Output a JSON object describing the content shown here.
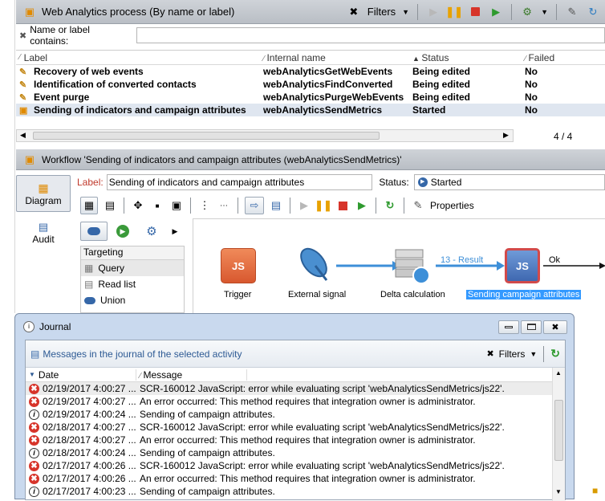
{
  "process": {
    "title": "Web Analytics process (By name or label)",
    "filters_label": "Filters",
    "search_label": "Name or label contains:",
    "search_value": "",
    "columns": [
      "Label",
      "Internal name",
      "Status",
      "Failed"
    ],
    "rows": [
      {
        "label": "Recovery of web events",
        "internal": "webAnalyticsGetWebEvents",
        "status": "Being edited",
        "failed": "No"
      },
      {
        "label": "Identification of converted contacts",
        "internal": "webAnalyticsFindConverted",
        "status": "Being edited",
        "failed": "No"
      },
      {
        "label": "Event purge",
        "internal": "webAnalyticsPurgeWebEvents",
        "status": "Being edited",
        "failed": "No"
      },
      {
        "label": "Sending of indicators and campaign attributes",
        "internal": "webAnalyticsSendMetrics",
        "status": "Started",
        "failed": "No"
      }
    ],
    "pager": "4 / 4"
  },
  "workflow": {
    "title": "Workflow 'Sending of indicators and campaign attributes (webAnalyticsSendMetrics)'",
    "label_caption": "Label:",
    "label_value": "Sending of indicators and campaign attributes",
    "status_caption": "Status:",
    "status_value": "Started",
    "side_diagram": "Diagram",
    "side_audit": "Audit",
    "properties_label": "Properties",
    "palette": {
      "header": "Targeting",
      "items": [
        "Query",
        "Read list",
        "Union"
      ]
    },
    "nodes": {
      "trigger": "Trigger",
      "external_signal": "External signal",
      "delta": "Delta calculation",
      "sending": "Sending campaign attributes",
      "js_text": "JS",
      "result_label": "13 - Result",
      "ok_label": "Ok"
    }
  },
  "journal": {
    "title": "Journal",
    "subtitle": "Messages in the journal of the selected activity",
    "filters_label": "Filters",
    "columns": [
      "Date",
      "Message"
    ],
    "rows": [
      {
        "type": "error",
        "date": "02/19/2017 4:00:27 ...",
        "msg": "SCR-160012 JavaScript: error while evaluating script 'webAnalyticsSendMetrics/js22'."
      },
      {
        "type": "error",
        "date": "02/19/2017 4:00:27 ...",
        "msg": "An error occurred: This method requires that integration owner is administrator."
      },
      {
        "type": "info",
        "date": "02/19/2017 4:00:24 ...",
        "msg": "Sending of campaign attributes."
      },
      {
        "type": "error",
        "date": "02/18/2017 4:00:27 ...",
        "msg": "SCR-160012 JavaScript: error while evaluating script 'webAnalyticsSendMetrics/js22'."
      },
      {
        "type": "error",
        "date": "02/18/2017 4:00:27 ...",
        "msg": "An error occurred: This method requires that integration owner is administrator."
      },
      {
        "type": "info",
        "date": "02/18/2017 4:00:24 ...",
        "msg": "Sending of campaign attributes."
      },
      {
        "type": "error",
        "date": "02/17/2017 4:00:26 ...",
        "msg": "SCR-160012 JavaScript: error while evaluating script 'webAnalyticsSendMetrics/js22'."
      },
      {
        "type": "error",
        "date": "02/17/2017 4:00:26 ...",
        "msg": "An error occurred: This method requires that integration owner is administrator."
      },
      {
        "type": "info",
        "date": "02/17/2017 4:00:23 ...",
        "msg": "Sending of campaign attributes."
      }
    ]
  },
  "colors": {
    "accent": "#3d8fd8",
    "error": "#d7342a",
    "titlebar": "#c3c8ce",
    "selected": "#3399ff"
  }
}
